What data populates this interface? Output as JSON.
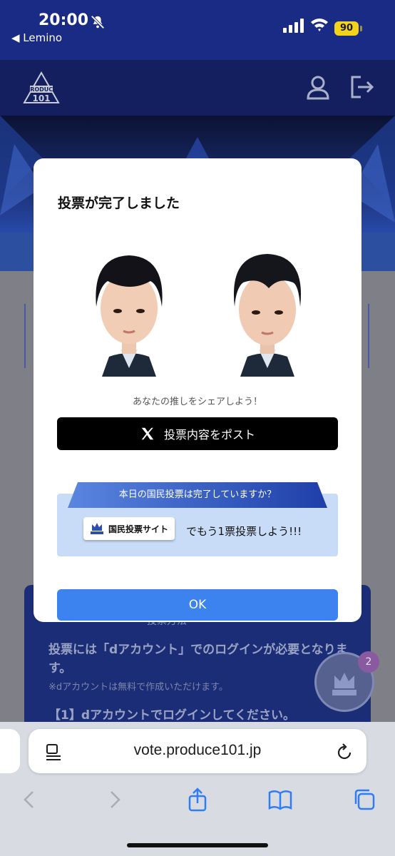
{
  "status_bar": {
    "time": "20:00",
    "back_app": "◀ Lemino",
    "battery": "90"
  },
  "site": {
    "logo_name": "PRODUCE 101 JAPAN SHINSEKAI"
  },
  "modal": {
    "title": "投票が完了しました",
    "share_text": "あなたの推しをシェアしよう！",
    "post_button": "投票内容をポスト",
    "promo_banner": "本日の国民投票は完了していますか？",
    "promo_site_button": "国民投票サイト",
    "promo_text": "でもう1票投票しよう!!!",
    "ok_button": "OK"
  },
  "background_card": {
    "heading": "投票方法",
    "text1": "投票には「dアカウント」でのログインが必要となります。",
    "text2": "※dアカウントは無料で作成いただけます。",
    "text3": "【1】dアカウントでログインしてください。"
  },
  "fab": {
    "badge": "2"
  },
  "safari": {
    "url": "vote.produce101.jp"
  },
  "colors": {
    "status_bar": "#1a2b86",
    "header": "#131f5e",
    "ok_button": "#3c83f0",
    "promo_bg": "#c9dcf7"
  }
}
